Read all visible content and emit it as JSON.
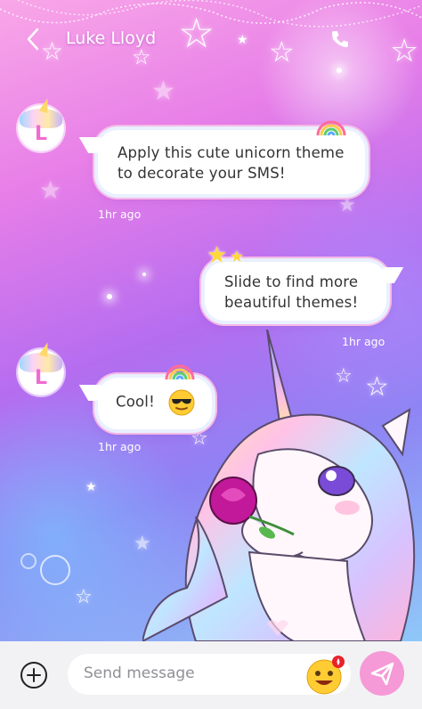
{
  "header": {
    "contact_name": "Luke Lloyd",
    "back_icon": "chevron-left-icon",
    "call_icon": "phone-icon"
  },
  "messages": [
    {
      "direction": "incoming",
      "avatar_letter": "L",
      "line1": "Apply this cute unicorn theme",
      "line2": "to decorate your SMS!",
      "time": "1hr ago"
    },
    {
      "direction": "outgoing",
      "line1": "Slide to find more",
      "line2": "beautiful themes!",
      "time": "1hr ago"
    },
    {
      "direction": "incoming",
      "avatar_letter": "L",
      "text": "Cool!",
      "emoji": "sunglasses-emoji",
      "time": "1hr ago"
    }
  ],
  "composer": {
    "placeholder": "Send message",
    "add_icon": "plus-circle-icon",
    "emoji_icon": "smiley-emoji-icon",
    "send_icon": "paper-plane-icon"
  },
  "colors": {
    "accent": "#f59ad6",
    "bubble_border": "#f6b9e8",
    "bar_bg": "#f2f2f4"
  }
}
